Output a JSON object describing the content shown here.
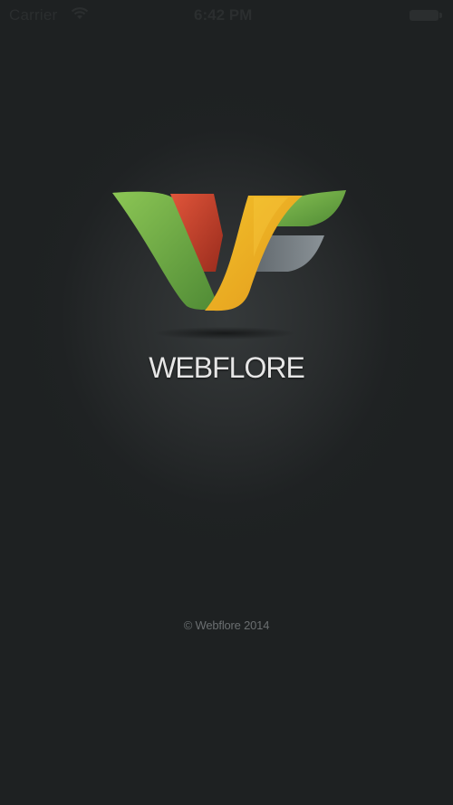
{
  "status_bar": {
    "carrier": "Carrier",
    "time": "6:42 PM",
    "wifi_icon": "wifi-icon",
    "battery_icon": "battery-icon"
  },
  "splash": {
    "logo_icon": "webflore-logo-icon",
    "app_name": "WEBFLORE",
    "copyright": "© Webflore 2014"
  },
  "colors": {
    "background": "#1e2122",
    "logo_green": "#79b54a",
    "logo_red": "#c8432c",
    "logo_yellow": "#e9ad21",
    "logo_gray": "#6c7378",
    "text": "#e6e6e6"
  }
}
